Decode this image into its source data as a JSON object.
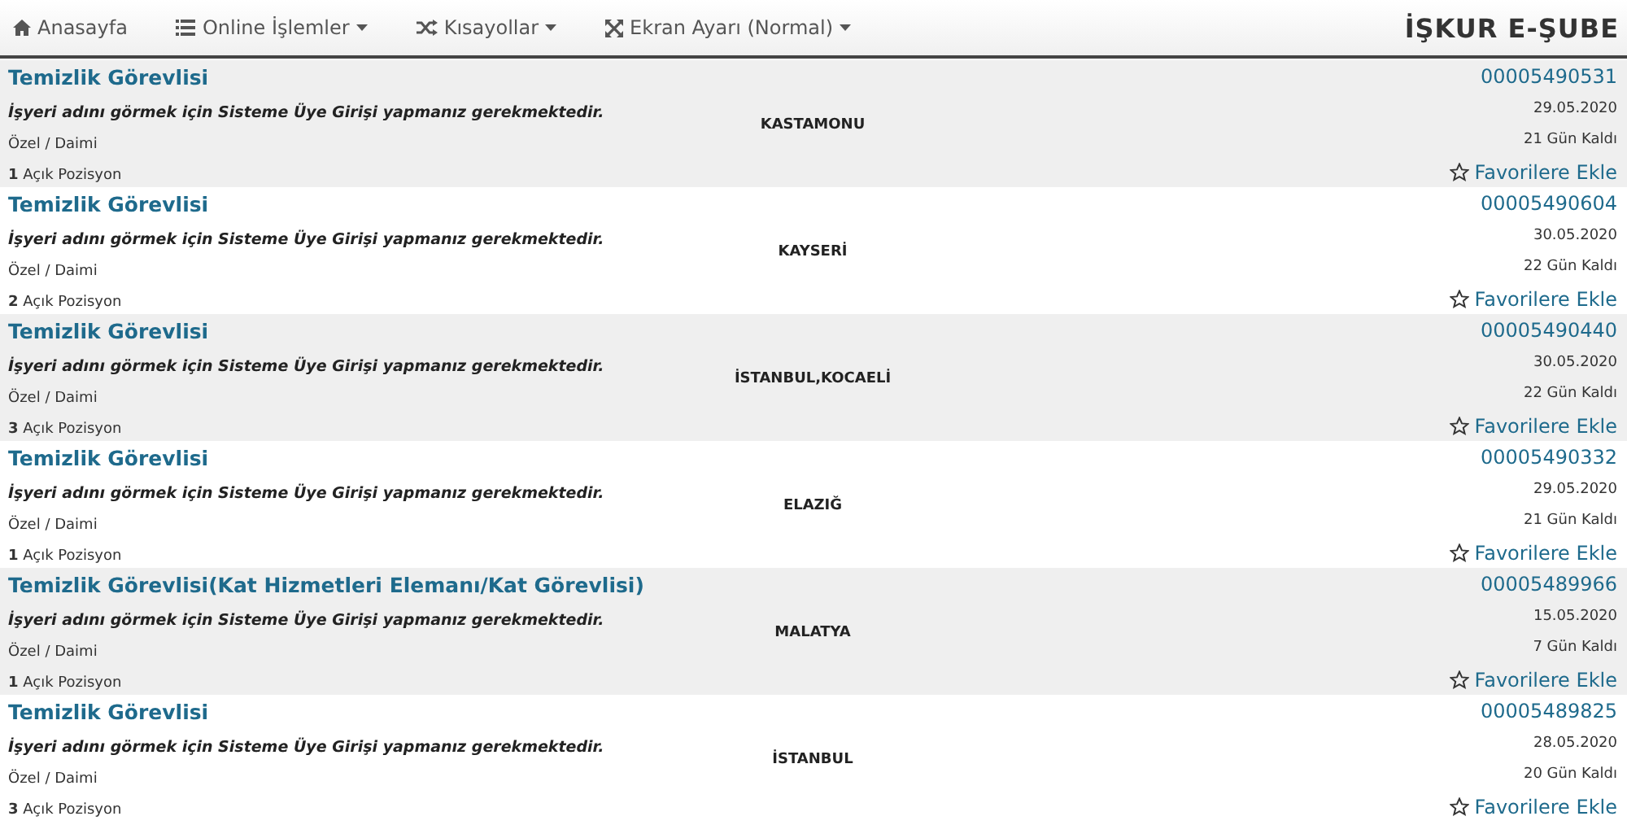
{
  "nav": {
    "items": [
      {
        "label": "Anasayfa",
        "kind": "home",
        "dropdown": false
      },
      {
        "label": "Online İşlemler",
        "kind": "list",
        "dropdown": true
      },
      {
        "label": "Kısayollar",
        "kind": "shortcuts",
        "dropdown": true
      },
      {
        "label": "Ekran Ayarı (Normal)",
        "kind": "display",
        "dropdown": true
      }
    ],
    "brand": "İŞKUR E-ŞUBE"
  },
  "jobs": [
    {
      "title": "Temizlik Görevlisi",
      "notice": "İşyeri adını görmek için Sisteme Üye Girişi yapmanız gerekmektedir.",
      "type": "Özel / Daimi",
      "positions": "**1** Açık Pozisyon",
      "city": "KASTAMONU",
      "id": "00005490531",
      "date": "29.05.2020",
      "remaining": "21 Gün Kaldı",
      "favorite": "Favorilere Ekle"
    },
    {
      "title": "Temizlik Görevlisi",
      "notice": "İşyeri adını görmek için Sisteme Üye Girişi yapmanız gerekmektedir.",
      "type": "Özel / Daimi",
      "positions": "**2** Açık Pozisyon",
      "city": "KAYSERİ",
      "id": "00005490604",
      "date": "30.05.2020",
      "remaining": "22 Gün Kaldı",
      "favorite": "Favorilere Ekle"
    },
    {
      "title": "Temizlik Görevlisi",
      "notice": "İşyeri adını görmek için Sisteme Üye Girişi yapmanız gerekmektedir.",
      "type": "Özel / Daimi",
      "positions": "**3** Açık Pozisyon",
      "city": "İSTANBUL,KOCAELİ",
      "id": "00005490440",
      "date": "30.05.2020",
      "remaining": "22 Gün Kaldı",
      "favorite": "Favorilere Ekle"
    },
    {
      "title": "Temizlik Görevlisi",
      "notice": "İşyeri adını görmek için Sisteme Üye Girişi yapmanız gerekmektedir.",
      "type": "Özel / Daimi",
      "positions": "**1** Açık Pozisyon",
      "city": "ELAZIĞ",
      "id": "00005490332",
      "date": "29.05.2020",
      "remaining": "21 Gün Kaldı",
      "favorite": "Favorilere Ekle"
    },
    {
      "title": "Temizlik Görevlisi(Kat Hizmetleri Elemanı/Kat Görevlisi)",
      "notice": "İşyeri adını görmek için Sisteme Üye Girişi yapmanız gerekmektedir.",
      "type": "Özel / Daimi",
      "positions": "**1** Açık Pozisyon",
      "city": "MALATYA",
      "id": "00005489966",
      "date": "15.05.2020",
      "remaining": "7 Gün Kaldı",
      "favorite": "Favorilere Ekle"
    },
    {
      "title": "Temizlik Görevlisi",
      "notice": "İşyeri adını görmek için Sisteme Üye Girişi yapmanız gerekmektedir.",
      "type": "Özel / Daimi",
      "positions": "**3** Açık Pozisyon",
      "city": "İSTANBUL",
      "id": "00005489825",
      "date": "28.05.2020",
      "remaining": "20 Gün Kaldı",
      "favorite": "Favorilere Ekle"
    }
  ]
}
